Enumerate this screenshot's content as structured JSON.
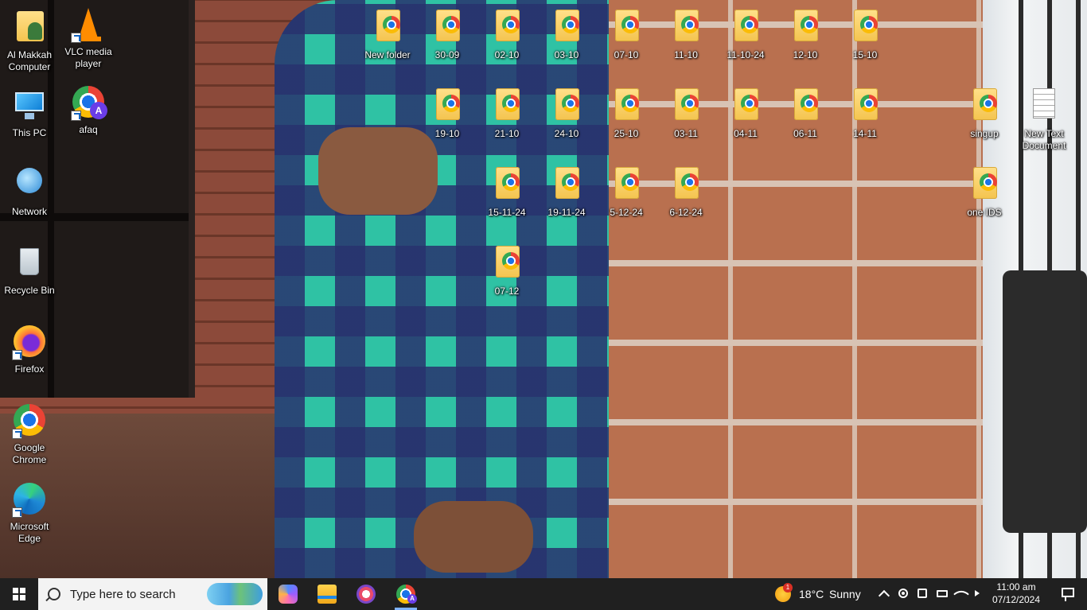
{
  "desktop": {
    "icons_left": [
      {
        "label": "Al Makkah Computer",
        "icon": "user-folder-icon"
      },
      {
        "label": "VLC media player",
        "icon": "vlc-icon"
      },
      {
        "label": "This PC",
        "icon": "this-pc-icon"
      },
      {
        "label": "afaq",
        "icon": "chrome-profile-icon"
      },
      {
        "label": "Network",
        "icon": "network-icon"
      },
      {
        "label": "Recycle Bin",
        "icon": "recycle-bin-icon"
      },
      {
        "label": "Firefox",
        "icon": "firefox-icon"
      },
      {
        "label": "Google Chrome",
        "icon": "chrome-icon"
      },
      {
        "label": "Microsoft Edge",
        "icon": "edge-icon"
      }
    ],
    "folders": [
      "New folder",
      "30-09",
      "02-10",
      "03-10",
      "07-10",
      "11-10",
      "11-10-24",
      "12-10",
      "15-10",
      "19-10",
      "21-10",
      "24-10",
      "25-10",
      "03-11",
      "04-11",
      "06-11",
      "14-11",
      "singup",
      "15-11-24",
      "19-11-24",
      "5-12-24",
      "6-12-24",
      "one IDS",
      "07-12"
    ],
    "text_document": "New Text Document"
  },
  "taskbar": {
    "search_placeholder": "Type here to search",
    "apps": [
      "copilot-icon",
      "file-explorer-icon",
      "snipping-tool-icon",
      "chrome-icon"
    ],
    "weather": {
      "temp": "18°C",
      "condition": "Sunny",
      "badge": "1"
    },
    "clock": {
      "time": "11:00 am",
      "date": "07/12/2024"
    },
    "tray": [
      "chevron-up-icon",
      "record-icon",
      "camera-icon",
      "battery-icon",
      "wifi-icon",
      "volume-icon"
    ]
  }
}
